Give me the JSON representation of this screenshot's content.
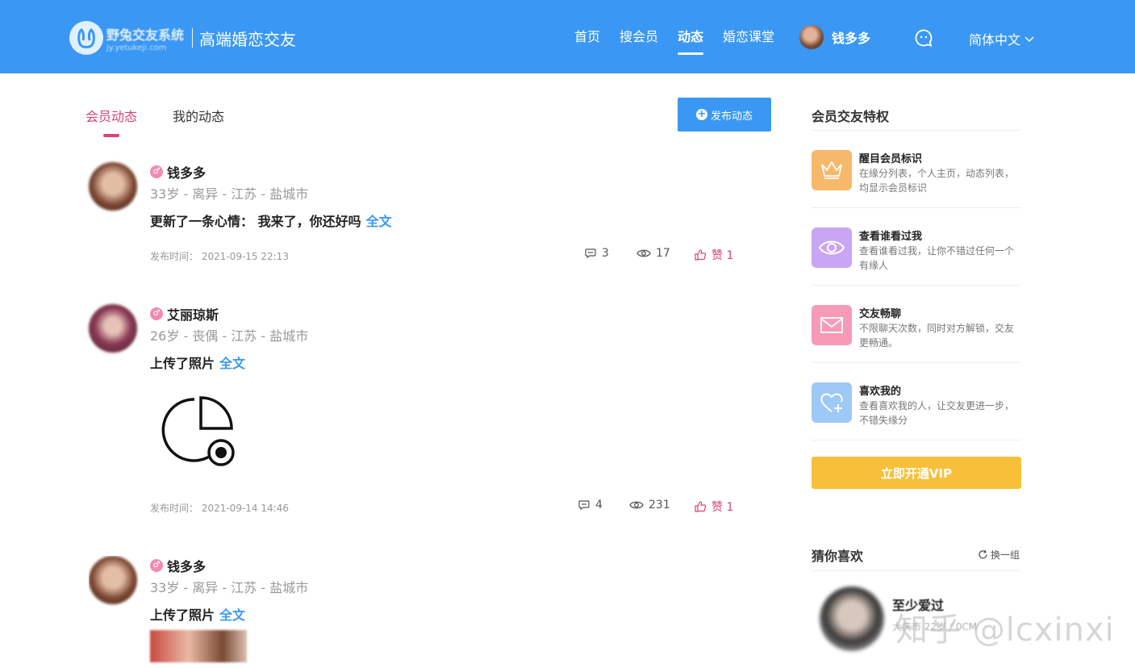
{
  "header": {
    "logo_name": "野兔交友系统",
    "logo_url": "jy.yetukeji.com",
    "slogan": "高端婚恋交友",
    "nav": [
      {
        "label": "首页"
      },
      {
        "label": "搜会员"
      },
      {
        "label": "动态"
      },
      {
        "label": "婚恋课堂"
      }
    ],
    "user_name": "钱多多",
    "language": "简体中文"
  },
  "tabs": [
    {
      "label": "会员动态"
    },
    {
      "label": "我的动态"
    }
  ],
  "publish_button": "发布动态",
  "posts": [
    {
      "name": "钱多多",
      "gender_symbol": "♂",
      "meta": "33岁 - 离异 - 江苏 - 盐城市",
      "content": "更新了一条心情：  我来了，你还好吗",
      "more": "全文",
      "time": "发布时间：  2021-09-15 22:13",
      "comments": "3",
      "views": "17",
      "likes": "赞 1"
    },
    {
      "name": "艾丽琼斯",
      "gender_symbol": "♂",
      "meta": "26岁 - 丧偶 - 江苏 - 盐城市",
      "content": "上传了照片",
      "more": "全文",
      "time": "发布时间：  2021-09-14 14:46",
      "comments": "4",
      "views": "231",
      "likes": "赞 1"
    },
    {
      "name": "钱多多",
      "gender_symbol": "♂",
      "meta": "33岁 - 离异 - 江苏 - 盐城市",
      "content": "上传了照片",
      "more": "全文"
    }
  ],
  "sidebar": {
    "privileges_title": "会员交友特权",
    "privileges": [
      {
        "title": "醒目会员标识",
        "desc": "在缘分列表，个人主页，动态列表，均显示会员标识",
        "icon": "crown-icon",
        "color": "#f8b86a"
      },
      {
        "title": "查看谁看过我",
        "desc": "查看谁看过我，让你不错过任何一个有缘人",
        "icon": "eye-icon",
        "color": "#c9a6f4"
      },
      {
        "title": "交友畅聊",
        "desc": "不限聊天次数，同时对方解锁，交友更畅通。",
        "icon": "mail-icon",
        "color": "#f79ab8"
      },
      {
        "title": "喜欢我的",
        "desc": "查看喜欢我的人，让交友更进一步，不错失缘分",
        "icon": "heart-plus-icon",
        "color": "#9ec8f6"
      }
    ],
    "vip_button": "立即开通VIP",
    "guess_title": "猜你喜欢",
    "refresh_label": "换一组",
    "guess_user": {
      "name": "至少爱过",
      "meta": "大庆市 22岁 / 0CM"
    }
  },
  "watermark": "知乎 @lcxinxi"
}
